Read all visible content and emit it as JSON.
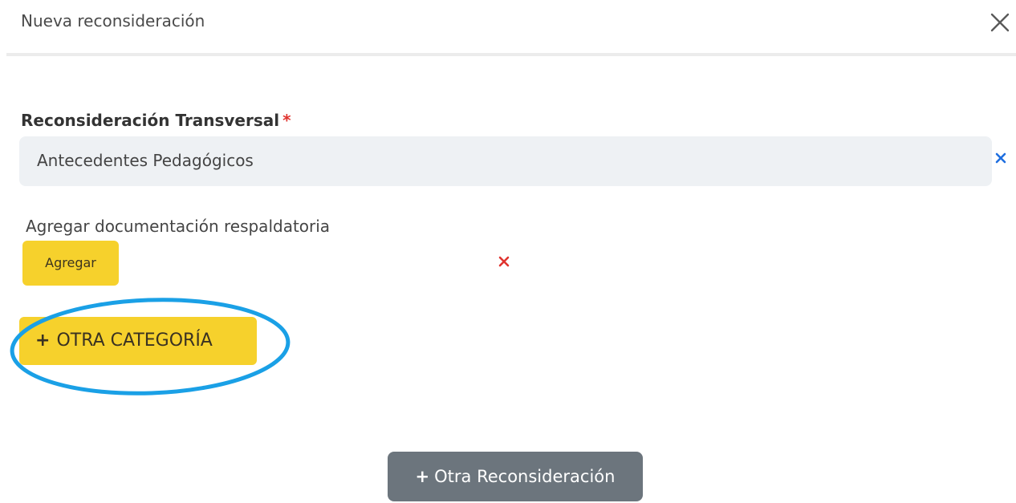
{
  "modal": {
    "title": "Nueva reconsideración",
    "close_icon": "close-icon"
  },
  "transversal": {
    "label": "Reconsideración Transversal",
    "required_marker": "*",
    "selected_value": "Antecedentes Pedagógicos",
    "clear_icon": "clear-x-icon"
  },
  "documentacion": {
    "label": "Agregar documentación respaldatoria",
    "add_button_label": "Agregar",
    "remove_icon": "remove-x-icon"
  },
  "otra_categoria": {
    "plus": "+",
    "label": "OTRA CATEGORÍA"
  },
  "otra_reconsideracion": {
    "plus": "+",
    "label": "Otra Reconsideración"
  },
  "colors": {
    "accent_yellow": "#f6d12c",
    "secondary_gray": "#6c757d",
    "required_red": "#e0342f",
    "clear_blue": "#1f6fe0",
    "annotation_blue": "#1aa0e6"
  }
}
